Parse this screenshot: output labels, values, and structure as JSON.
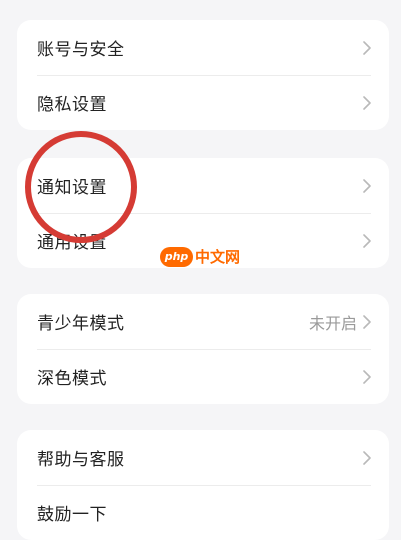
{
  "groups": [
    {
      "items": [
        {
          "label": "账号与安全"
        },
        {
          "label": "隐私设置"
        }
      ]
    },
    {
      "items": [
        {
          "label": "通知设置"
        },
        {
          "label": "通用设置"
        }
      ]
    },
    {
      "items": [
        {
          "label": "青少年模式",
          "value": "未开启"
        },
        {
          "label": "深色模式"
        }
      ]
    },
    {
      "items": [
        {
          "label": "帮助与客服"
        },
        {
          "label": "鼓励一下"
        }
      ]
    }
  ],
  "watermark": {
    "logo": "php",
    "text": "中文网"
  },
  "colors": {
    "background": "#f5f5f7",
    "card": "#ffffff",
    "highlight": "#d53b34",
    "watermark": "#ff6a00"
  }
}
